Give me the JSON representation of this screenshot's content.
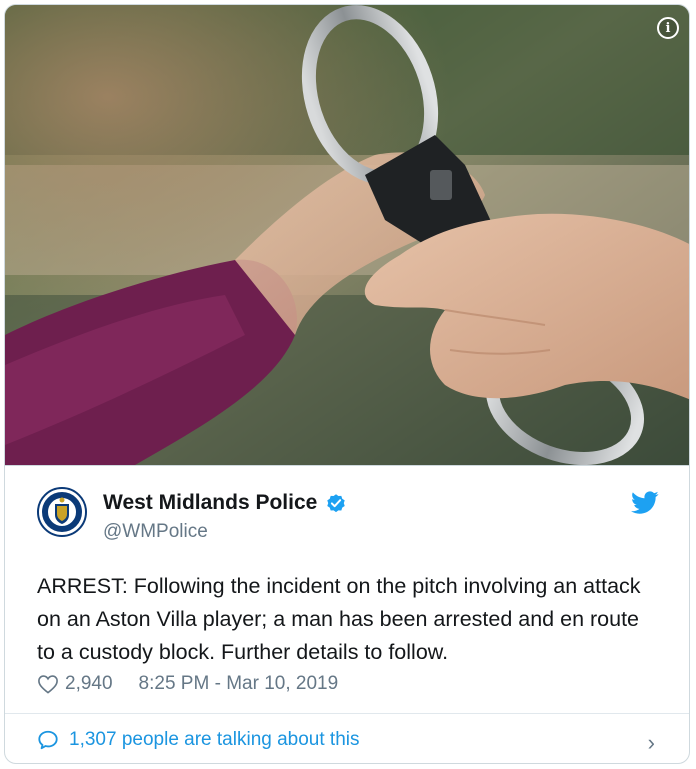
{
  "media": {
    "info_icon": "info-icon",
    "info_symbol": "i"
  },
  "author": {
    "name": "West Midlands Police",
    "handle": "@WMPolice",
    "verified_icon": "verified-badge-icon",
    "avatar_icon": "west-midlands-police-crest"
  },
  "brand_icon": "twitter-bird-icon",
  "tweet": {
    "text": "ARREST: Following the incident on the pitch involving an attack on an Aston Villa player; a man has been arrested and en route to a custody block. Further details to follow."
  },
  "meta": {
    "likes": "2,940",
    "timestamp": "8:25 PM - Mar 10, 2019"
  },
  "footer": {
    "talking": "1,307 people are talking about this",
    "chevron": "›"
  },
  "colors": {
    "link": "#1b95e0",
    "muted": "#657786",
    "verified": "#1da1f2"
  }
}
